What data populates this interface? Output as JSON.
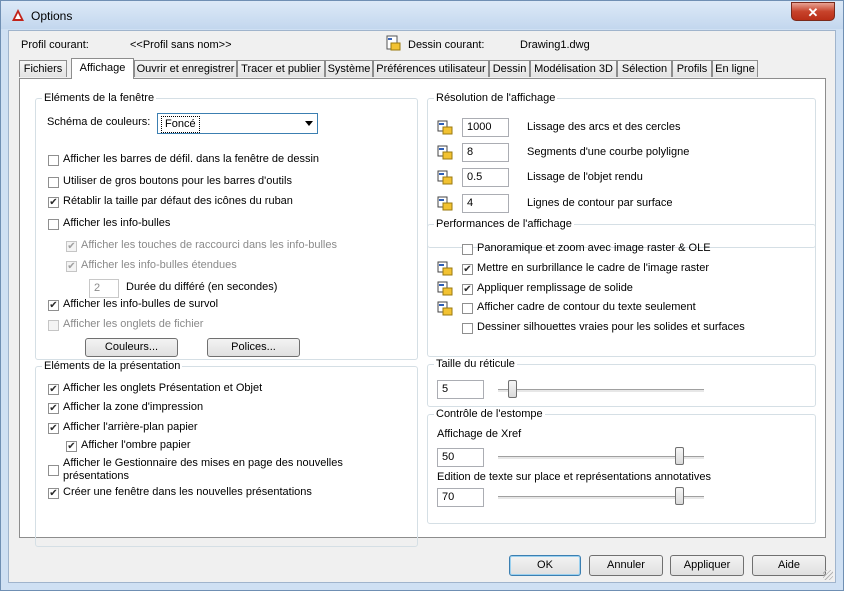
{
  "window": {
    "title": "Options",
    "close": "✕"
  },
  "header": {
    "profile_label": "Profil courant:",
    "profile_value": "<<Profil sans nom>>",
    "drawing_label": "Dessin courant:",
    "drawing_value": "Drawing1.dwg"
  },
  "tabs": [
    "Fichiers",
    "Affichage",
    "Ouvrir et enregistrer",
    "Tracer et publier",
    "Système",
    "Préférences utilisateur",
    "Dessin",
    "Modélisation 3D",
    "Sélection",
    "Profils",
    "En ligne"
  ],
  "active_tab": "Affichage",
  "window_elements": {
    "title": "Eléments de la fenêtre",
    "color_scheme_label": "Schéma de couleurs:",
    "color_scheme_value": "Foncé",
    "options": [
      {
        "label": "Afficher les barres de défil. dans la fenêtre de dessin",
        "checked": false,
        "enabled": true
      },
      {
        "label": "Utiliser de gros boutons pour les barres d'outils",
        "checked": false,
        "enabled": true
      },
      {
        "label": "Rétablir la taille par défaut des icônes du ruban",
        "checked": true,
        "enabled": true
      },
      {
        "label": "Afficher les info-bulles",
        "checked": false,
        "enabled": true
      },
      {
        "label": "Afficher les touches de raccourci dans les info-bulles",
        "checked": true,
        "enabled": false
      },
      {
        "label": "Afficher les info-bulles étendues",
        "checked": true,
        "enabled": false
      },
      {
        "label": "Afficher les info-bulles de survol",
        "checked": true,
        "enabled": true
      },
      {
        "label": "Afficher les onglets de fichier",
        "checked": false,
        "enabled": false
      }
    ],
    "delay_value": "2",
    "delay_label": "Durée du différé (en secondes)",
    "colors_button": "Couleurs...",
    "fonts_button": "Polices..."
  },
  "layout_elements": {
    "title": "Eléments de la présentation",
    "options": [
      {
        "label": "Afficher les onglets Présentation et Objet",
        "checked": true
      },
      {
        "label": "Afficher la zone d'impression",
        "checked": true
      },
      {
        "label": "Afficher l'arrière-plan papier",
        "checked": true
      },
      {
        "label": "Afficher l'ombre papier",
        "checked": true
      },
      {
        "label": "Afficher le Gestionnaire des mises en page des nouvelles",
        "label2": "présentations",
        "checked": false
      },
      {
        "label": "Créer une fenêtre dans les nouvelles présentations",
        "checked": true
      }
    ]
  },
  "display_resolution": {
    "title": "Résolution de l'affichage",
    "rows": [
      {
        "value": "1000",
        "label": "Lissage des arcs et des cercles"
      },
      {
        "value": "8",
        "label": "Segments d'une courbe polyligne"
      },
      {
        "value": "0.5",
        "label": "Lissage de l'objet rendu"
      },
      {
        "value": "4",
        "label": "Lignes de contour par surface"
      }
    ]
  },
  "display_performance": {
    "title": "Performances de l'affichage",
    "options": [
      {
        "label": "Panoramique et zoom avec image raster & OLE",
        "checked": false,
        "icon": false
      },
      {
        "label": "Mettre en surbrillance le cadre de l'image raster",
        "checked": true,
        "icon": true
      },
      {
        "label": "Appliquer remplissage de solide",
        "checked": true,
        "icon": true
      },
      {
        "label": "Afficher cadre de contour du texte seulement",
        "checked": false,
        "icon": true
      },
      {
        "label": "Dessiner silhouettes vraies pour les solides et surfaces",
        "checked": false,
        "icon": false
      }
    ]
  },
  "crosshair": {
    "title": "Taille du réticule",
    "value": "5",
    "fraction": 0.05
  },
  "fade_control": {
    "title": "Contrôle de l'estompe",
    "xref_label": "Affichage de Xref",
    "xref_value": "50",
    "xref_fraction": 0.9,
    "inplace_label": "Edition de texte sur place et représentations annotatives",
    "inplace_value": "70",
    "inplace_fraction": 0.9
  },
  "footer": {
    "ok": "OK",
    "cancel": "Annuler",
    "apply": "Appliquer",
    "help": "Aide"
  },
  "colors": {
    "frame": "#cfe0f3",
    "panel": "#ffffff",
    "accent": "#3c7fb1"
  }
}
